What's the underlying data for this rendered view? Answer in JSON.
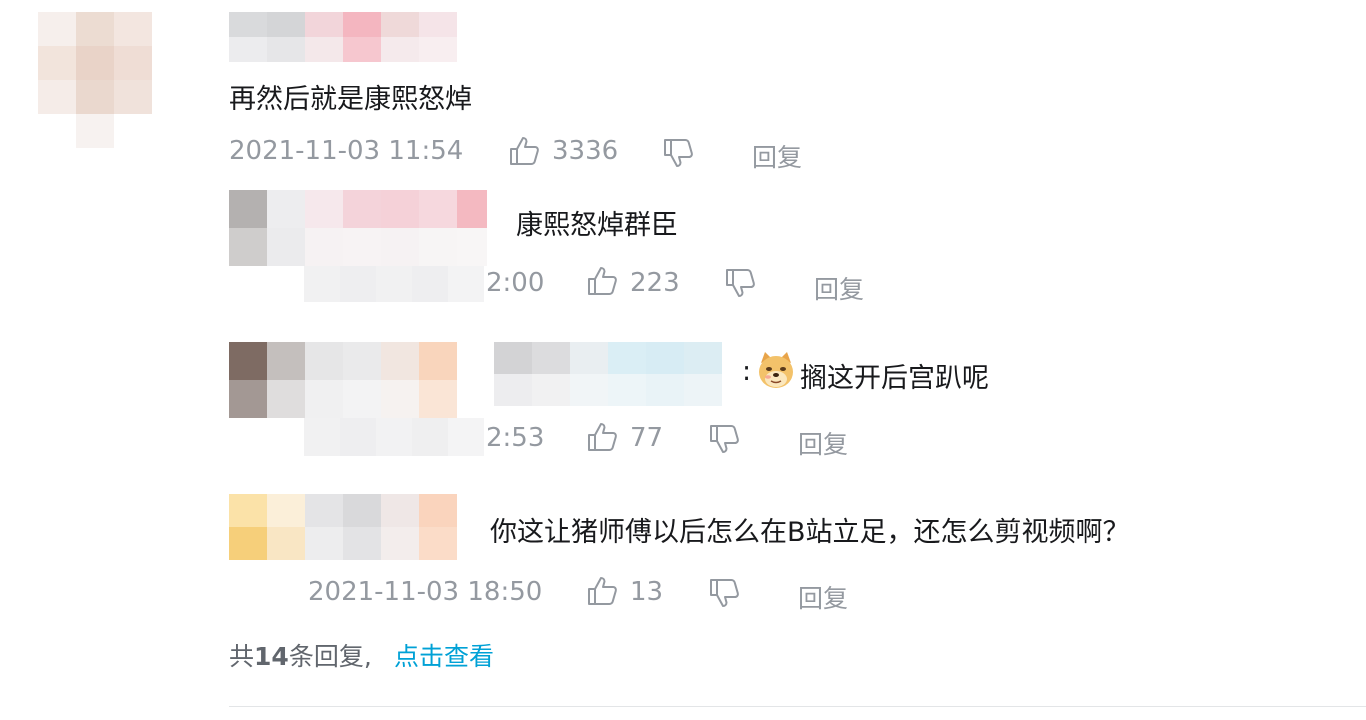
{
  "main_comment": {
    "text": "再然后就是康熙怒焯",
    "timestamp": "2021-11-03 11:54",
    "likes": "3336",
    "reply_label": "回复"
  },
  "replies": [
    {
      "text": "康熙怒焯群臣",
      "timestamp_partial": "2:00",
      "likes": "223",
      "reply_label": "回复"
    },
    {
      "text_prefix": ":",
      "emoji_name": "doge-emoji",
      "text": "搁这开后宫趴呢",
      "timestamp_partial": "2:53",
      "likes": "77",
      "reply_label": "回复"
    },
    {
      "text": "你这让猪师傅以后怎么在B站立足，还怎么剪视频啊？",
      "timestamp": "2021-11-03 18:50",
      "likes": "13",
      "reply_label": "回复"
    }
  ],
  "footer": {
    "prefix": "共",
    "count": "14",
    "suffix": "条回复,",
    "view_link": "点击查看"
  },
  "icons": {
    "like": "thumbs-up-icon",
    "dislike": "thumbs-down-icon"
  }
}
